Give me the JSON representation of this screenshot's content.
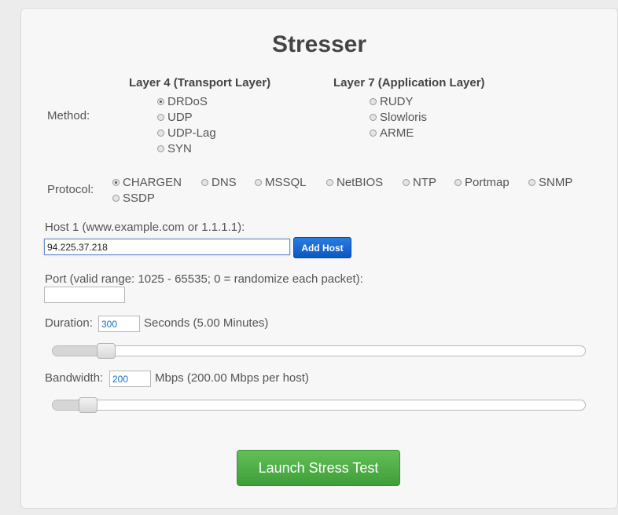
{
  "title": "Stresser",
  "method": {
    "label": "Method:",
    "layer4": {
      "heading": "Layer 4 (Transport Layer)",
      "options": [
        {
          "label": "DRDoS",
          "checked": true
        },
        {
          "label": "UDP",
          "checked": false
        },
        {
          "label": "UDP-Lag",
          "checked": false
        },
        {
          "label": "SYN",
          "checked": false
        }
      ]
    },
    "layer7": {
      "heading": "Layer 7 (Application Layer)",
      "options": [
        {
          "label": "RUDY",
          "checked": false
        },
        {
          "label": "Slowloris",
          "checked": false
        },
        {
          "label": "ARME",
          "checked": false
        }
      ]
    }
  },
  "protocol": {
    "label": "Protocol:",
    "options": [
      {
        "label": "CHARGEN",
        "checked": true
      },
      {
        "label": "DNS",
        "checked": false
      },
      {
        "label": "MSSQL",
        "checked": false
      },
      {
        "label": "NetBIOS",
        "checked": false
      },
      {
        "label": "NTP",
        "checked": false
      },
      {
        "label": "Portmap",
        "checked": false
      },
      {
        "label": "SNMP",
        "checked": false
      },
      {
        "label": "SSDP",
        "checked": false
      }
    ]
  },
  "host": {
    "label": "Host 1 (www.example.com or 1.1.1.1):",
    "value": "94.225.37.218",
    "add_button": "Add Host"
  },
  "port": {
    "label": "Port (valid range: 1025 - 65535; 0 = randomize each packet):",
    "value": ""
  },
  "duration": {
    "label": "Duration:",
    "value": "300",
    "suffix": "Seconds (5.00 Minutes)",
    "slider_fraction": 0.085
  },
  "bandwidth": {
    "label": "Bandwidth:",
    "value": "200",
    "suffix": "Mbps (200.00 Mbps per host)",
    "slider_fraction": 0.05
  },
  "launch_button": "Launch Stress Test"
}
